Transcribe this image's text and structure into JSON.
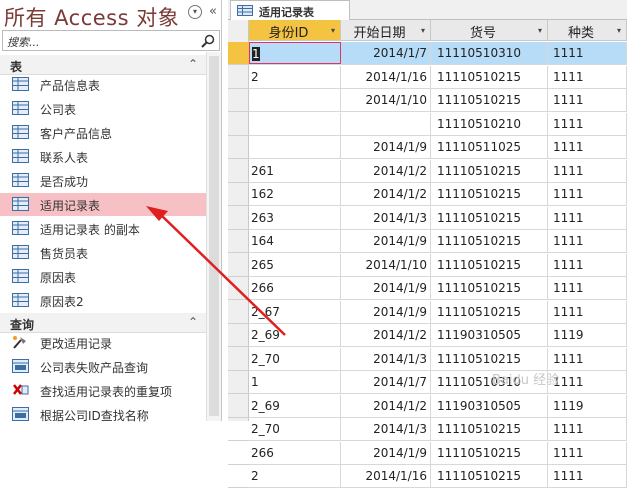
{
  "nav": {
    "title": "所有 Access 对象",
    "menu_glyph": "▾",
    "collapse_glyph": "«",
    "search_placeholder": "搜索...",
    "groups": [
      {
        "label": "表",
        "chevron": "⌃"
      },
      {
        "label": "查询",
        "chevron": "⌃"
      }
    ],
    "tables": [
      {
        "label": "产品信息表",
        "selected": false
      },
      {
        "label": "公司表",
        "selected": false
      },
      {
        "label": "客户产品信息",
        "selected": false
      },
      {
        "label": "联系人表",
        "selected": false
      },
      {
        "label": "是否成功",
        "selected": false
      },
      {
        "label": "适用记录表",
        "selected": true
      },
      {
        "label": "适用记录表 的副本",
        "selected": false
      },
      {
        "label": "售货员表",
        "selected": false
      },
      {
        "label": "原因表",
        "selected": false
      },
      {
        "label": "原因表2",
        "selected": false
      }
    ],
    "queries": [
      {
        "label": "更改适用记录",
        "icon": "update-query-icon"
      },
      {
        "label": "公司表失败产品查询",
        "icon": "select-query-icon"
      },
      {
        "label": "查找适用记录表的重复项",
        "icon": "find-duplicates-icon"
      },
      {
        "label": "根据公司ID查找名称",
        "icon": "select-query-icon"
      }
    ]
  },
  "datasheet": {
    "tab_label": "适用记录表",
    "columns": [
      "身份ID",
      "开始日期",
      "货号",
      "种类"
    ],
    "rows": [
      {
        "id": "1",
        "date": "2014/1/7",
        "code": "11110510310",
        "kind": "1111",
        "active": true
      },
      {
        "id": "2",
        "date": "2014/1/16",
        "code": "11110510215",
        "kind": "1111"
      },
      {
        "id": "",
        "date": "2014/1/10",
        "code": "11110510215",
        "kind": "1111"
      },
      {
        "id": "",
        "date": "",
        "code": "11110510210",
        "kind": "1111"
      },
      {
        "id": "",
        "date": "2014/1/9",
        "code": "11110511025",
        "kind": "1111"
      },
      {
        "id": "261",
        "date": "2014/1/2",
        "code": "11110510215",
        "kind": "1111"
      },
      {
        "id": "162",
        "date": "2014/1/2",
        "code": "11110510215",
        "kind": "1111"
      },
      {
        "id": "263",
        "date": "2014/1/3",
        "code": "11110510215",
        "kind": "1111"
      },
      {
        "id": "164",
        "date": "2014/1/9",
        "code": "11110510215",
        "kind": "1111"
      },
      {
        "id": "265",
        "date": "2014/1/10",
        "code": "11110510215",
        "kind": "1111"
      },
      {
        "id": "266",
        "date": "2014/1/9",
        "code": "11110510215",
        "kind": "1111"
      },
      {
        "id": "2_67",
        "date": "2014/1/9",
        "code": "11110510215",
        "kind": "1111"
      },
      {
        "id": "2_69",
        "date": "2014/1/2",
        "code": "11190310505",
        "kind": "1119"
      },
      {
        "id": "2_70",
        "date": "2014/1/3",
        "code": "11110510215",
        "kind": "1111"
      },
      {
        "id": "1",
        "date": "2014/1/7",
        "code": "11110510310",
        "kind": "1111"
      },
      {
        "id": "2_69",
        "date": "2014/1/2",
        "code": "11190310505",
        "kind": "1119"
      },
      {
        "id": "2_70",
        "date": "2014/1/3",
        "code": "11110510215",
        "kind": "1111"
      },
      {
        "id": "266",
        "date": "2014/1/9",
        "code": "11110510215",
        "kind": "1111"
      },
      {
        "id": "2",
        "date": "2014/1/16",
        "code": "11110510215",
        "kind": "1111"
      }
    ]
  },
  "watermark": "Baidu 经验",
  "colors": {
    "title": "#7a3b37",
    "selected_nav": "#f7c0c4",
    "active_header": "#f5c342",
    "active_row": "#b7dcf7",
    "arrow": "#e02020"
  }
}
